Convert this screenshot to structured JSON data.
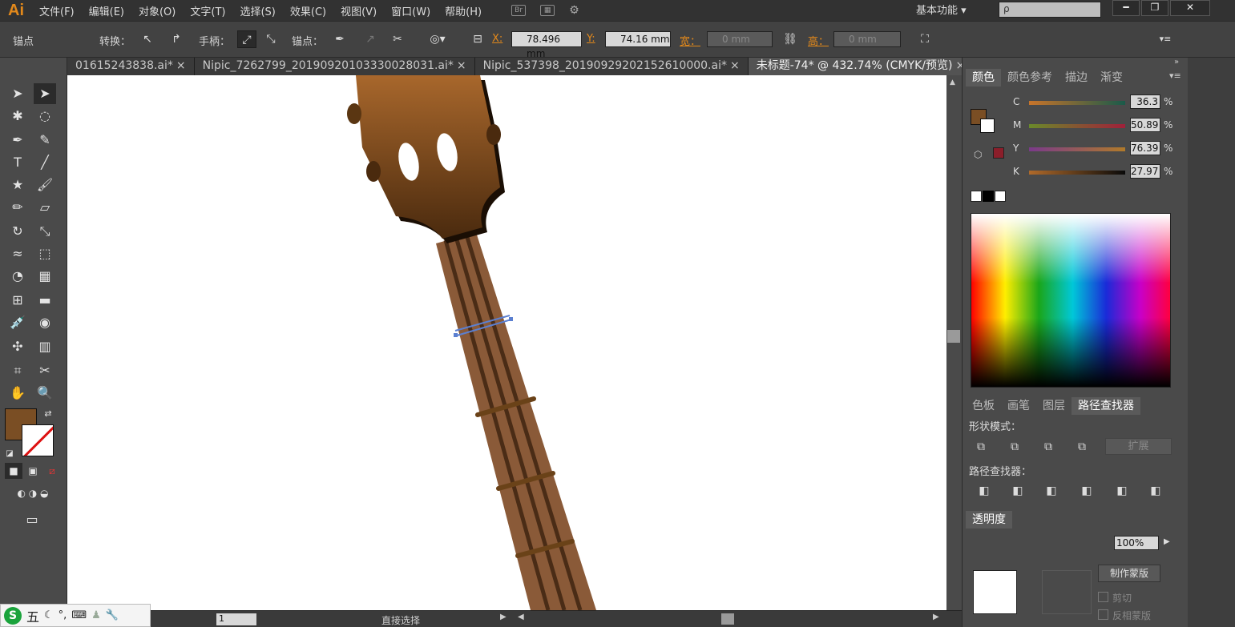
{
  "app": {
    "logo": "Ai",
    "menu": [
      "文件(F)",
      "编辑(E)",
      "对象(O)",
      "文字(T)",
      "选择(S)",
      "效果(C)",
      "视图(V)",
      "窗口(W)",
      "帮助(H)"
    ],
    "workspace": "基本功能",
    "workspace_arrow": "▾",
    "search_placeholder": "ρ",
    "window_buttons": [
      "━",
      "❐",
      "✕"
    ]
  },
  "controlbar": {
    "anchor_label": "锚点",
    "convert_label": "转换：",
    "handle_label": "手柄：",
    "anchor_point_label": "锚点：",
    "x_label": "X:",
    "x_value": "78.496 mm",
    "y_label": "Y:",
    "y_value": "74.16 mm",
    "w_label": "宽：",
    "w_value": "0 mm",
    "h_label": "高：",
    "h_value": "0 mm"
  },
  "tabs": [
    {
      "label": "01615243838.ai*",
      "close": "×",
      "active": false
    },
    {
      "label": "Nipic_7262799_20190920103330028031.ai*",
      "close": "×",
      "active": false
    },
    {
      "label": "Nipic_537398_20190929202152610000.ai*",
      "close": "×",
      "active": false
    },
    {
      "label": "未标题-74* @ 432.74% (CMYK/预览)",
      "close": "×",
      "active": true
    }
  ],
  "tabs_overflow": "»",
  "color_panel": {
    "tabs": [
      "颜色",
      "颜色参考",
      "描边",
      "渐变"
    ],
    "channels": [
      {
        "name": "C",
        "value": "36.3",
        "unit": "%",
        "color": "#7a5020"
      },
      {
        "name": "M",
        "value": "50.89",
        "unit": "%",
        "color": "#6a3a3a"
      },
      {
        "name": "Y",
        "value": "76.39",
        "unit": "%",
        "color": "#7a5a7a"
      },
      {
        "name": "K",
        "value": "27.97",
        "unit": "%",
        "color": "#7a4e24"
      }
    ],
    "fill_color": "#7a4e24"
  },
  "pathfinder_panel": {
    "tabs": [
      "色板",
      "画笔",
      "图层",
      "路径查找器"
    ],
    "shape_modes_label": "形状模式：",
    "expand_label": "扩展",
    "pathfinders_label": "路径查找器："
  },
  "transparency_panel": {
    "tab": "透明度",
    "opacity": "100%",
    "make_mask": "制作蒙版",
    "clip": "剪切",
    "invert_mask": "反相蒙版"
  },
  "statusbar": {
    "zoom": "1",
    "tool": "直接选择"
  },
  "ime": {
    "logo": "S",
    "label": "五"
  },
  "guitar": {
    "fill_color": "#7a4e24"
  }
}
